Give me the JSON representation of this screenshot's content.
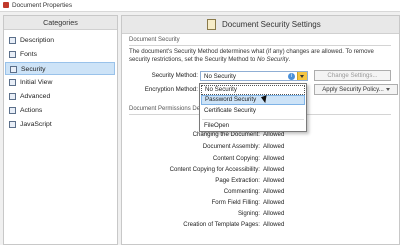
{
  "window": {
    "title": "Document Properties"
  },
  "categories": {
    "header": "Categories",
    "items": [
      {
        "label": "Description",
        "selected": false
      },
      {
        "label": "Fonts",
        "selected": false
      },
      {
        "label": "Security",
        "selected": true
      },
      {
        "label": "Initial View",
        "selected": false
      },
      {
        "label": "Advanced",
        "selected": false
      },
      {
        "label": "Actions",
        "selected": false
      },
      {
        "label": "JavaScript",
        "selected": false
      }
    ]
  },
  "security": {
    "panel_title": "Document Security Settings",
    "section_title": "Document Security",
    "description_prefix": "The document's Security Method determines what (if any) changes are allowed. To remove security restrictions, set the Security Method to ",
    "description_emph": "No Security",
    "description_suffix": ".",
    "method_label": "Security Method:",
    "method_value": "No Security",
    "encryption_label": "Encryption Method:",
    "change_settings_label": "Change Settings...",
    "apply_policy_label": "Apply Security Policy...",
    "restrictions_title": "Document Permissions De",
    "dropdown_options": [
      "No Security",
      "Password Security",
      "Certificate Security",
      "FileOpen"
    ],
    "permissions": [
      {
        "label": "Changing the Document:",
        "value": "Allowed"
      },
      {
        "label": "Document Assembly:",
        "value": "Allowed"
      },
      {
        "label": "Content Copying:",
        "value": "Allowed"
      },
      {
        "label": "Content Copying for Accessibility:",
        "value": "Allowed"
      },
      {
        "label": "Page Extraction:",
        "value": "Allowed"
      },
      {
        "label": "Commenting:",
        "value": "Allowed"
      },
      {
        "label": "Form Field Filling:",
        "value": "Allowed"
      },
      {
        "label": "Signing:",
        "value": "Allowed"
      },
      {
        "label": "Creation of Template Pages:",
        "value": "Allowed"
      }
    ]
  },
  "colors": {
    "selection": "#cde3f7",
    "selection_border": "#7fb3e6",
    "accent_arrow": "#f4c542",
    "info_icon": "#4a90d9"
  }
}
